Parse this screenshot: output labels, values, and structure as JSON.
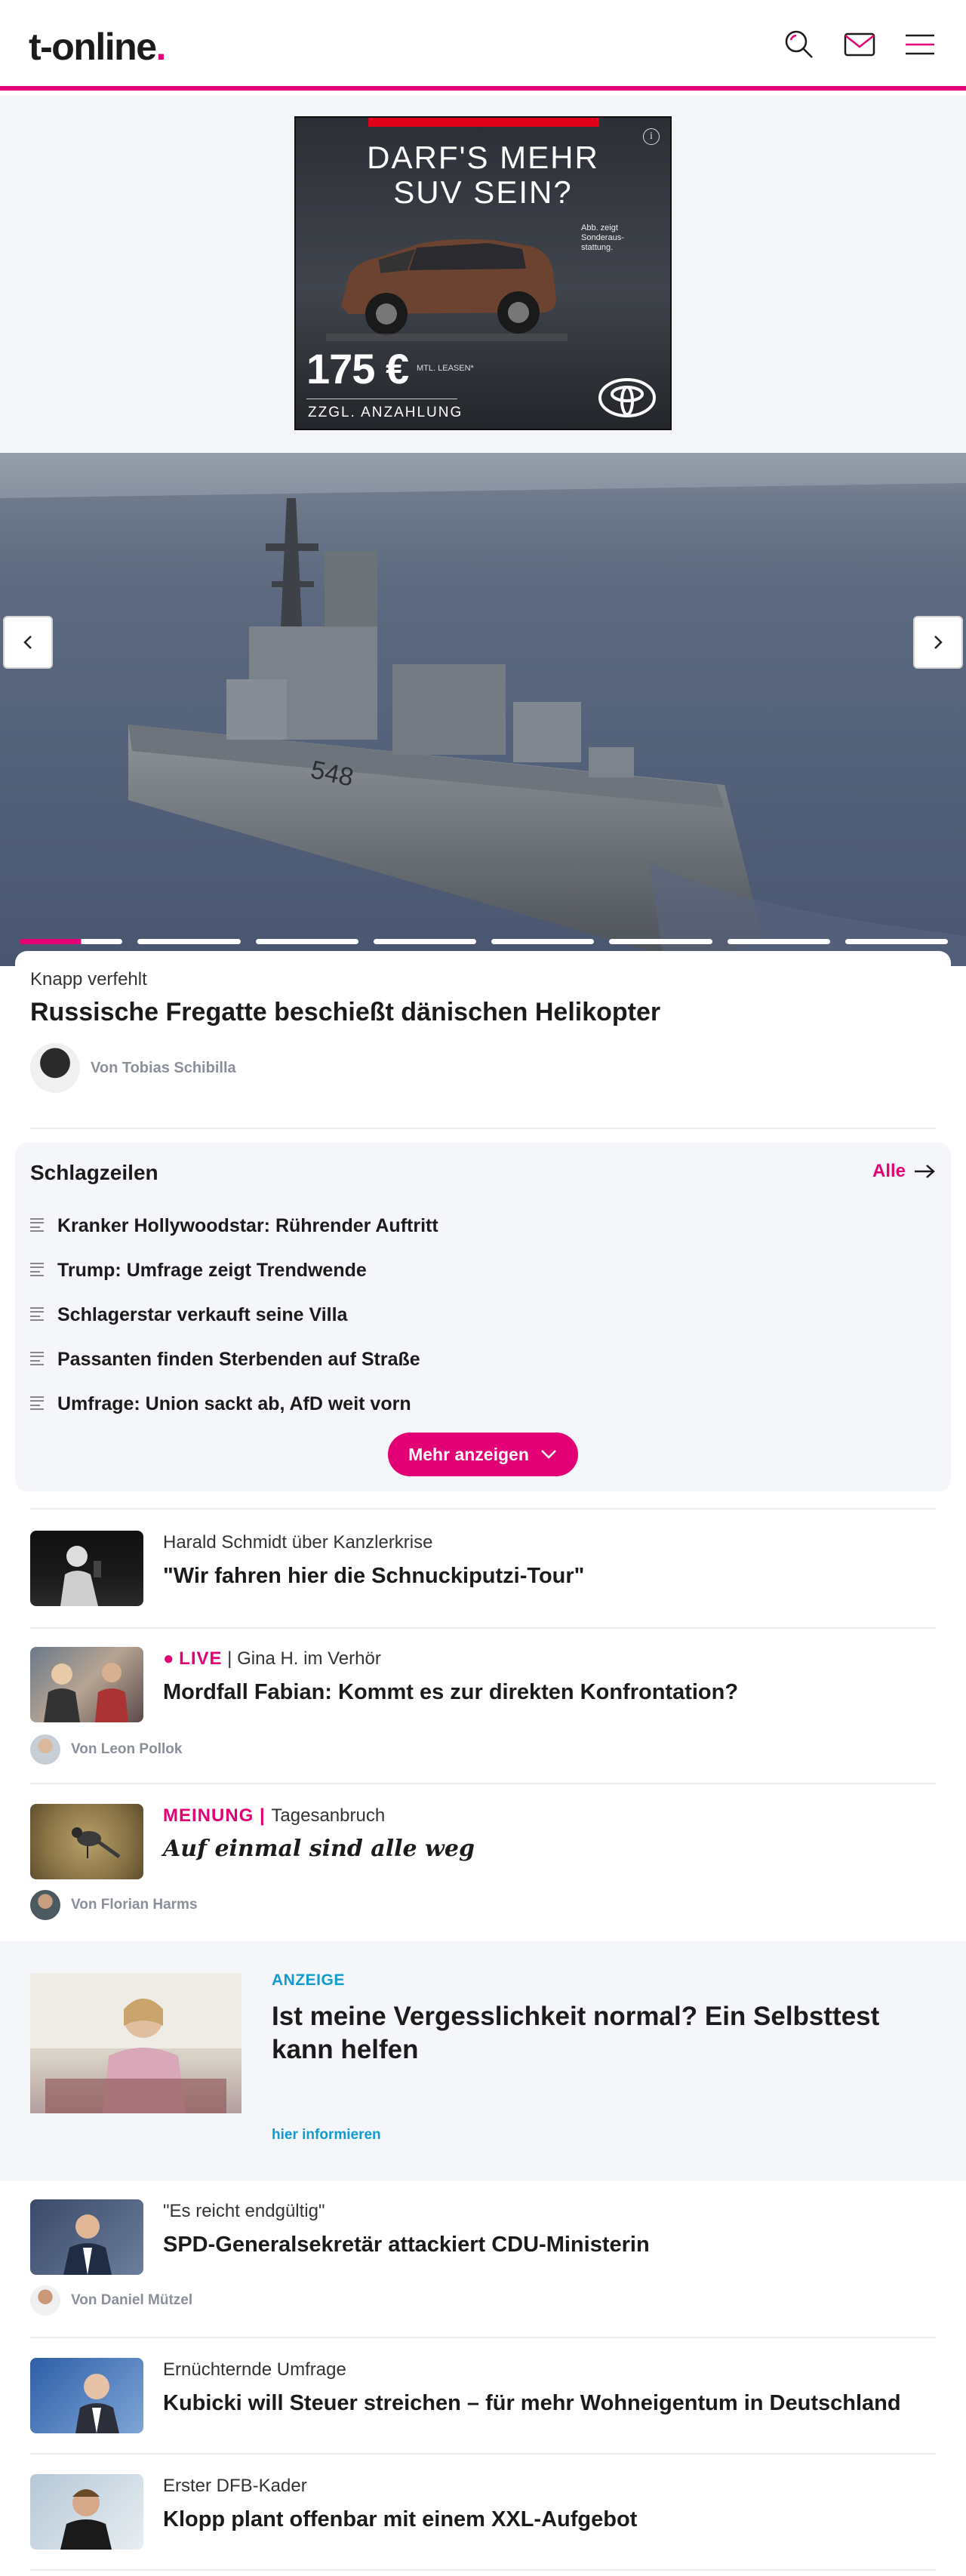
{
  "header": {
    "logo_text": "t-online",
    "logo_dot": ".",
    "accent": "#e20074",
    "icons": [
      "search-icon",
      "mail-icon",
      "menu-icon"
    ]
  },
  "ad_banner": {
    "headline_line1": "DARF'S MEHR",
    "headline_line2": "SUV SEIN?",
    "note": "Abb. zeigt Sonderaus-stattung.",
    "price": "175 €",
    "price_sub": "MTL. LEASEN*",
    "zzgl": "ZZGL. ANZAHLUNG",
    "info": "i"
  },
  "hero": {
    "slide_count": 8,
    "active_slide": 1,
    "prev_icon": "chevron-left-icon",
    "next_icon": "chevron-right-icon"
  },
  "lead": {
    "kicker": "Knapp verfehlt",
    "title": "Russische Fregatte beschießt dänischen Helikopter",
    "author": "Von Tobias Schibilla"
  },
  "schlagzeilen": {
    "title": "Schlagzeilen",
    "all_label": "Alle",
    "items": [
      "Kranker Hollywoodstar: Rührender Auftritt",
      "Trump: Umfrage zeigt Trendwende",
      "Schlagerstar verkauft seine Villa",
      "Passanten finden Sterbenden auf Straße",
      "Umfrage: Union sackt ab, AfD weit vorn"
    ],
    "more_label": "Mehr anzeigen"
  },
  "teasers": [
    {
      "kicker": "Harald Schmidt über Kanzlerkrise",
      "title": "\"Wir fahren hier die Schnuckiputzi-Tour\""
    },
    {
      "live_label": "LIVE",
      "kicker": "Gina H. im Verhör",
      "title": "Mordfall Fabian: Kommt es zur direkten Konfrontation?",
      "author": "Von Leon Pollok"
    },
    {
      "opinion_label": "MEINUNG",
      "kicker": "Tagesanbruch",
      "title": "Auf einmal sind alle weg",
      "author": "Von Florian Harms"
    }
  ],
  "sponsored": {
    "label": "ANZEIGE",
    "title": "Ist meine Vergesslichkeit normal? Ein Selbsttest kann helfen",
    "link": "hier informieren"
  },
  "teasers_more": [
    {
      "kicker": "\"Es reicht endgültig\"",
      "title": "SPD-Generalsekretär attackiert CDU-Ministerin",
      "author": "Von Daniel Mützel"
    },
    {
      "kicker": "Ernüchternde Umfrage",
      "title": "Kubicki will Steuer streichen – für mehr Wohneigentum in Deutschland"
    },
    {
      "kicker": "Erster DFB-Kader",
      "title": "Klopp plant offenbar mit einem XXL-Aufgebot"
    }
  ]
}
